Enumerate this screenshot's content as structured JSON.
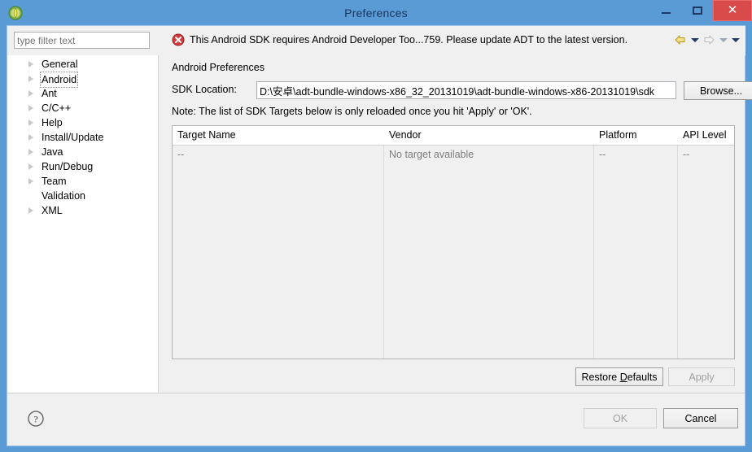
{
  "window": {
    "title": "Preferences",
    "app_icon": "eclipse-icon",
    "controls": {
      "minimize": "minimize-icon",
      "maximize": "maximize-icon",
      "close": "✕"
    }
  },
  "filter": {
    "placeholder": "type filter text",
    "value": ""
  },
  "message_bar": {
    "icon": "error-icon",
    "text": "This Android SDK requires Android Developer Too...759.  Please update ADT to the latest version.",
    "nav": {
      "back": "back-arrow-icon",
      "back_menu": "chevron-down-icon",
      "forward": "forward-arrow-icon",
      "forward_menu": "chevron-down-icon",
      "view_menu": "chevron-down-icon"
    }
  },
  "sidebar": {
    "items": [
      {
        "label": "General",
        "expandable": true,
        "selected": false
      },
      {
        "label": "Android",
        "expandable": true,
        "selected": true
      },
      {
        "label": "Ant",
        "expandable": true,
        "selected": false
      },
      {
        "label": "C/C++",
        "expandable": true,
        "selected": false
      },
      {
        "label": "Help",
        "expandable": true,
        "selected": false
      },
      {
        "label": "Install/Update",
        "expandable": true,
        "selected": false
      },
      {
        "label": "Java",
        "expandable": true,
        "selected": false
      },
      {
        "label": "Run/Debug",
        "expandable": true,
        "selected": false
      },
      {
        "label": "Team",
        "expandable": true,
        "selected": false
      },
      {
        "label": "Validation",
        "expandable": false,
        "selected": false
      },
      {
        "label": "XML",
        "expandable": true,
        "selected": false
      }
    ]
  },
  "main": {
    "pane_title": "Android Preferences",
    "sdk_location_label": "SDK Location:",
    "sdk_location_value": "D:\\安卓\\adt-bundle-windows-x86_32_20131019\\adt-bundle-windows-x86-20131019\\sdk",
    "browse_label": "Browse...",
    "note": "Note: The list of SDK Targets below is only reloaded once you hit 'Apply' or 'OK'.",
    "table": {
      "columns": [
        "Target Name",
        "Vendor",
        "Platform",
        "API Level"
      ],
      "rows": [
        [
          "--",
          "No target available",
          "--",
          "--"
        ]
      ]
    },
    "restore_defaults_label": "Restore Defaults",
    "restore_defaults_mnemonic": "D",
    "apply_label": "Apply",
    "apply_enabled": false
  },
  "footer": {
    "help_icon": "help-icon",
    "ok_label": "OK",
    "ok_enabled": false,
    "cancel_label": "Cancel"
  },
  "colors": {
    "titlebar": "#5b9bd5",
    "title_text": "#17365d",
    "close_button": "#d94a4a",
    "error_icon": "#d43c3c",
    "client_bg": "#f0f0f0"
  }
}
